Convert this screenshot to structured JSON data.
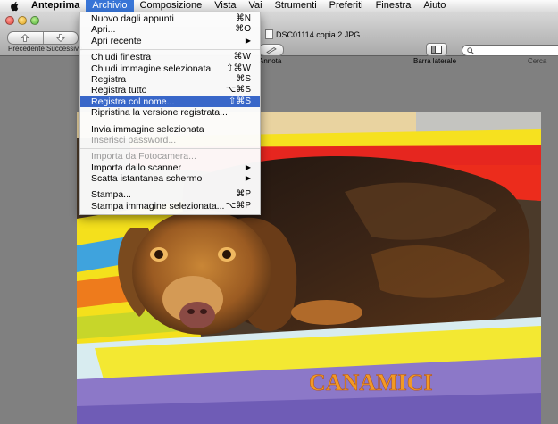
{
  "menubar": {
    "items": [
      "Anteprima",
      "Archivio",
      "Composizione",
      "Vista",
      "Vai",
      "Strumenti",
      "Preferiti",
      "Finestra",
      "Aiuto"
    ],
    "active": "Archivio"
  },
  "toolbar": {
    "prev_label": "Precedente",
    "next_label": "Successivo",
    "annota_label": "Annota",
    "sidebar_label": "Barra laterale",
    "search_label": "Cerca",
    "search_value": ""
  },
  "window": {
    "title": "DSC01114 copia 2.JPG"
  },
  "file_menu": {
    "groups": [
      [
        {
          "label": "Nuovo dagli appunti",
          "shortcut": "⌘N"
        },
        {
          "label": "Apri...",
          "shortcut": "⌘O"
        },
        {
          "label": "Apri recente",
          "submenu": "▶"
        }
      ],
      [
        {
          "label": "Chiudi finestra",
          "shortcut": "⌘W"
        },
        {
          "label": "Chiudi immagine selezionata",
          "shortcut": "⇧⌘W"
        },
        {
          "label": "Registra",
          "shortcut": "⌘S"
        },
        {
          "label": "Registra tutto",
          "shortcut": "⌥⌘S"
        },
        {
          "label": "Registra col nome...",
          "shortcut": "⇧⌘S",
          "highlighted": true
        },
        {
          "label": "Ripristina la versione registrata..."
        }
      ],
      [
        {
          "label": "Invia immagine selezionata",
          "shortcut": ""
        },
        {
          "label": "Inserisci password...",
          "disabled": true
        }
      ],
      [
        {
          "label": "Importa da Fotocamera...",
          "disabled": true
        },
        {
          "label": "Importa dallo scanner",
          "submenu": "▶"
        },
        {
          "label": "Scatta istantanea schermo",
          "submenu": "▶"
        }
      ],
      [
        {
          "label": "Stampa...",
          "shortcut": "⌘P"
        },
        {
          "label": "Stampa immagine selezionata...",
          "shortcut": "⌥⌘P"
        }
      ]
    ]
  },
  "photo": {
    "cushion_text": "CANAMICI"
  },
  "colors": {
    "menu_highlight": "#3967c9",
    "menubar_active": "#3875d7",
    "window_background": "#808080"
  }
}
